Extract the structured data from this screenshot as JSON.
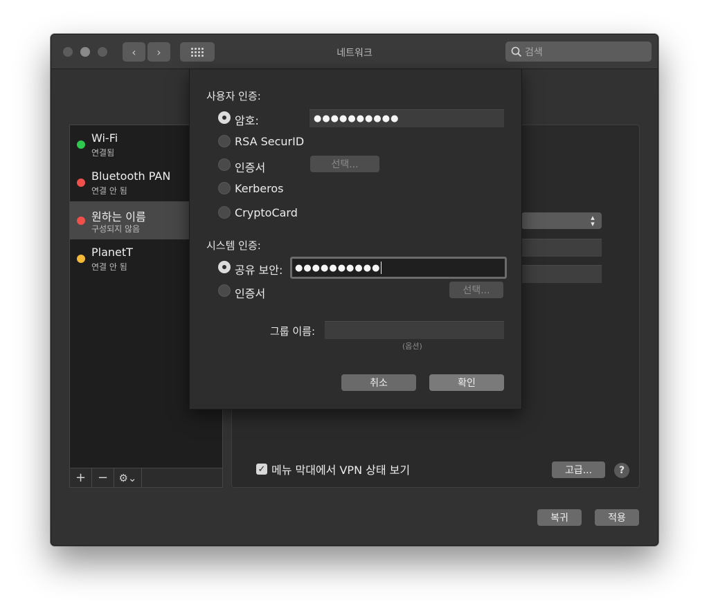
{
  "window": {
    "title": "네트워크",
    "search_placeholder": "검색",
    "nav_back": "‹",
    "nav_forward": "›"
  },
  "services": [
    {
      "name": "Wi-Fi",
      "status": "연결됨",
      "color": "#2fc950"
    },
    {
      "name": "Bluetooth PAN",
      "status": "연결 안 됨",
      "color": "#f0504a"
    },
    {
      "name": "원하는 이름",
      "status": "구성되지 않음",
      "color": "#f0504a",
      "selected": true
    },
    {
      "name": "PlanetT",
      "status": "연결 안 됨",
      "color": "#f5b93a"
    }
  ],
  "list_toolbar": {
    "add": "+",
    "remove": "−",
    "action": "⚙⌄"
  },
  "main": {
    "show_vpn_status_label": "메뉴 막대에서 VPN 상태 보기",
    "show_vpn_status_checked": true,
    "advanced_button": "고급...",
    "help_button": "?",
    "revert_button": "복귀",
    "apply_button": "적용"
  },
  "sheet": {
    "user_auth_label": "사용자 인증:",
    "user_auth_options": [
      {
        "label": "암호:",
        "selected": true
      },
      {
        "label": "RSA SecurID",
        "selected": false
      },
      {
        "label": "인증서",
        "selected": false
      },
      {
        "label": "Kerberos",
        "selected": false
      },
      {
        "label": "CryptoCard",
        "selected": false
      }
    ],
    "password_value": "●●●●●●●●●●",
    "user_cert_select_button": "선택...",
    "system_auth_label": "시스템 인증:",
    "system_auth_options": [
      {
        "label": "공유 보안:",
        "selected": true
      },
      {
        "label": "인증서",
        "selected": false
      }
    ],
    "shared_secret_value": "●●●●●●●●●●",
    "system_cert_select_button": "선택...",
    "group_name_label": "그룹 이름:",
    "group_name_value": "",
    "group_name_hint": "(옵션)",
    "cancel_button": "취소",
    "ok_button": "확인"
  }
}
